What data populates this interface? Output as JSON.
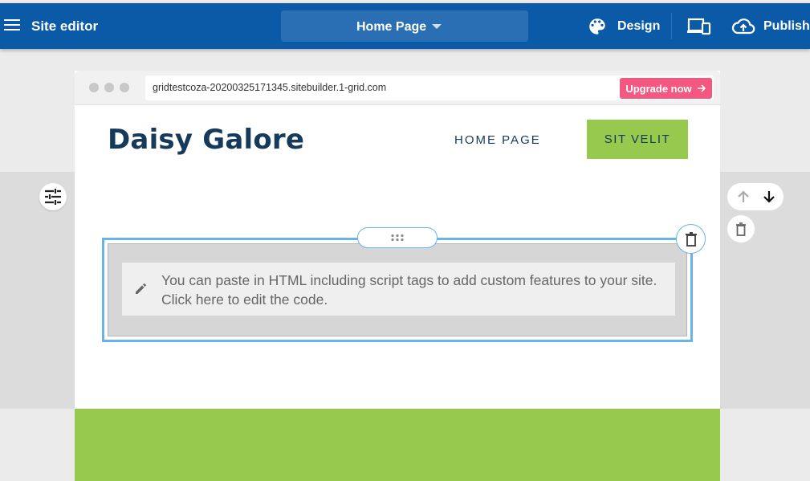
{
  "topbar": {
    "title": "Site editor",
    "page_selector": "Home Page",
    "design_label": "Design",
    "publish_label": "Publish"
  },
  "browser": {
    "url": "gridtestcoza-20200325171345.sitebuilder.1-grid.com",
    "upgrade_label": "Upgrade now"
  },
  "site": {
    "title": "Daisy Galore",
    "nav_home": "HOME PAGE",
    "nav_button": "SIT VELIT"
  },
  "html_block": {
    "note": "You can paste in HTML including script tags to add custom features to your site. Click here to edit the code."
  },
  "colors": {
    "topbar": "#0a5aa7",
    "accent_green": "#97c94e",
    "upgrade_pink": "#f4577f",
    "selection_blue": "#6ab3ea",
    "title_navy": "#153a5b"
  },
  "icons": [
    "menu-icon",
    "chevron-down-icon",
    "palette-icon",
    "devices-icon",
    "cloud-upload-icon",
    "settings-sliders-icon",
    "arrow-up-icon",
    "arrow-down-icon",
    "trash-icon",
    "pencil-icon",
    "drag-handle-icon",
    "arrow-right-icon"
  ]
}
